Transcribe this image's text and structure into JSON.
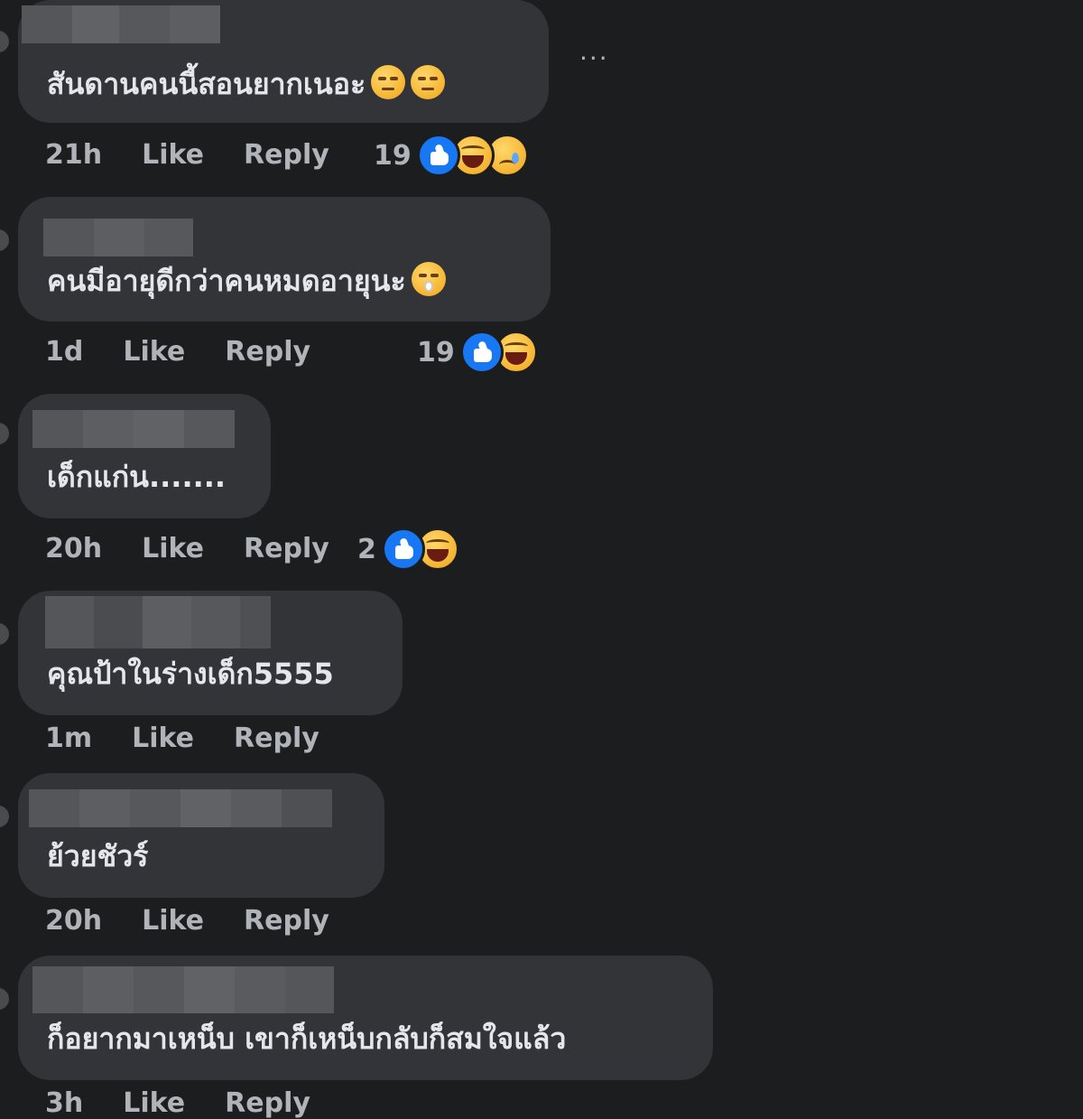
{
  "more_label": "···",
  "comments": [
    {
      "text": "สันดานคนนี้สอนยากเนอะ",
      "time": "21h",
      "like": "Like",
      "reply": "Reply",
      "reaction_count": "19",
      "reactions": [
        "like",
        "haha",
        "sad"
      ],
      "inline_emoji": [
        "unamused-emoji",
        "unamused-emoji"
      ]
    },
    {
      "text": "คนมีอายุดีกว่าคนหมดอายุนะ",
      "time": "1d",
      "like": "Like",
      "reply": "Reply",
      "reaction_count": "19",
      "reactions": [
        "like",
        "haha"
      ],
      "inline_emoji": [
        "shushing-emoji"
      ]
    },
    {
      "text": "เด็กแก่น.......",
      "time": "20h",
      "like": "Like",
      "reply": "Reply",
      "reaction_count": "2",
      "reactions": [
        "like",
        "haha"
      ],
      "inline_emoji": []
    },
    {
      "text": "คุณป้าในร่างเด็ก5555",
      "time": "1m",
      "like": "Like",
      "reply": "Reply",
      "reaction_count": "",
      "reactions": [],
      "inline_emoji": []
    },
    {
      "text": "ย้วยชัวร์",
      "time": "20h",
      "like": "Like",
      "reply": "Reply",
      "reaction_count": "",
      "reactions": [],
      "inline_emoji": []
    },
    {
      "text": "ก็อยากมาเหน็บ เขาก็เหน็บกลับก็สมใจแล้ว",
      "time": "3h",
      "like": "Like",
      "reply": "Reply",
      "reaction_count": "",
      "reactions": [],
      "inline_emoji": []
    }
  ]
}
